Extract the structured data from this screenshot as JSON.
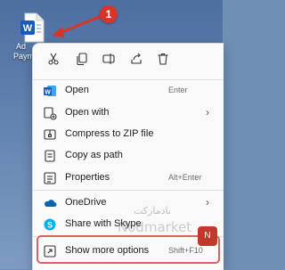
{
  "desktop": {
    "file_label_line1": "Ad",
    "file_label_line2": "Paym"
  },
  "annotation": {
    "step_number": "1",
    "accent_color": "#d9342a"
  },
  "quick_actions": [
    {
      "name": "cut-icon"
    },
    {
      "name": "copy-icon"
    },
    {
      "name": "rename-icon"
    },
    {
      "name": "share-icon"
    },
    {
      "name": "delete-icon"
    }
  ],
  "menu": {
    "open": {
      "label": "Open",
      "shortcut": "Enter"
    },
    "open_with": {
      "label": "Open with"
    },
    "compress": {
      "label": "Compress to ZIP file"
    },
    "copy_path": {
      "label": "Copy as path"
    },
    "properties": {
      "label": "Properties",
      "shortcut": "Alt+Enter"
    },
    "onedrive": {
      "label": "OneDrive"
    },
    "skype": {
      "label": "Share with Skype"
    },
    "more_options": {
      "label": "Show more options",
      "shortcut": "Shift+F10"
    }
  },
  "watermark": {
    "text_fa": "نادمارکت",
    "text_en": "Nodmarket"
  }
}
